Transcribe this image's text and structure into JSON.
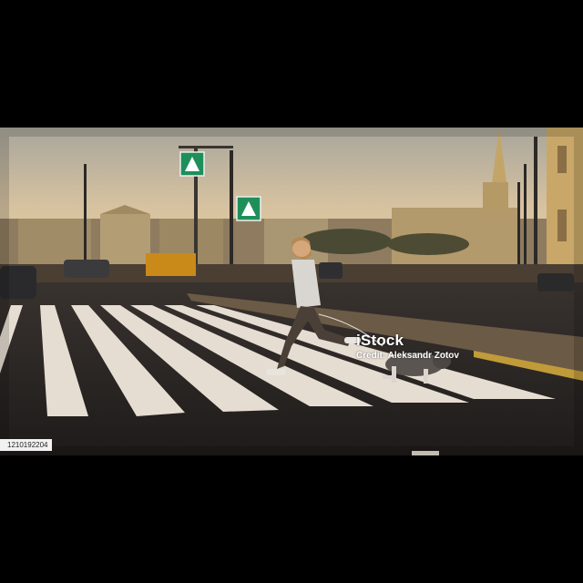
{
  "photo": {
    "subject": "woman running across zebra crossing with a dog"
  },
  "watermark": {
    "logo": "iStock",
    "credit": "Credit: Aleksandr Zotov"
  },
  "image_id": "1210192204",
  "colors": {
    "sky": "#c9b79a",
    "road": "#2a2624",
    "stripes": "#e6ddd2",
    "buildings": "#a48c64",
    "sign": "#1f8f5a"
  }
}
